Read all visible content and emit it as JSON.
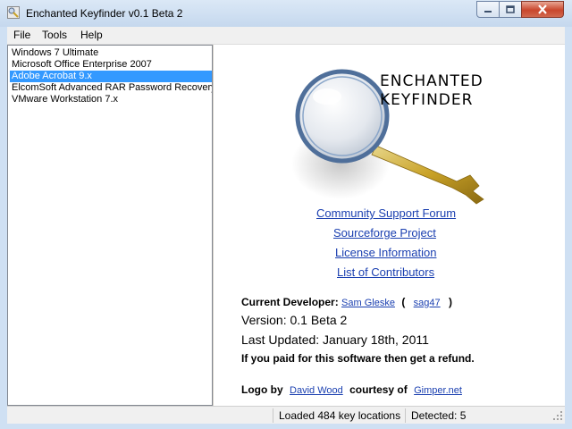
{
  "window": {
    "title": "Enchanted Keyfinder v0.1 Beta 2"
  },
  "menu": {
    "items": [
      "File",
      "Tools",
      "Help"
    ]
  },
  "sidebar": {
    "items": [
      {
        "label": "Windows 7 Ultimate",
        "selected": false
      },
      {
        "label": "Microsoft Office Enterprise 2007",
        "selected": false
      },
      {
        "label": "Adobe Acrobat 9.x",
        "selected": true
      },
      {
        "label": "ElcomSoft Advanced RAR Password Recovery",
        "selected": false
      },
      {
        "label": "VMware Workstation 7.x",
        "selected": false
      }
    ]
  },
  "logo": {
    "line1": "ENCHANTED",
    "line2": "KEYFINDER"
  },
  "links": {
    "community": "Community Support Forum",
    "sourceforge": "Sourceforge Project",
    "license": "License Information",
    "contributors": "List of Contributors"
  },
  "info": {
    "developer_label": "Current Developer:",
    "developer_name": "Sam Gleske",
    "paren_open": "(",
    "developer_handle": "sag47",
    "paren_close": ")",
    "version": "Version: 0.1 Beta 2",
    "updated": "Last Updated: January 18th, 2011",
    "refund": "If you paid for this software then get a refund.",
    "logo_by": "Logo by",
    "logo_author": "David Wood",
    "courtesy": "courtesy of",
    "courtesy_site": "Gimper.net"
  },
  "status": {
    "loaded": "Loaded 484 key locations",
    "detected": "Detected: 5"
  },
  "colors": {
    "selection": "#3399ff",
    "link": "#1a3fb0",
    "titlebar": "#cfe0f3"
  }
}
